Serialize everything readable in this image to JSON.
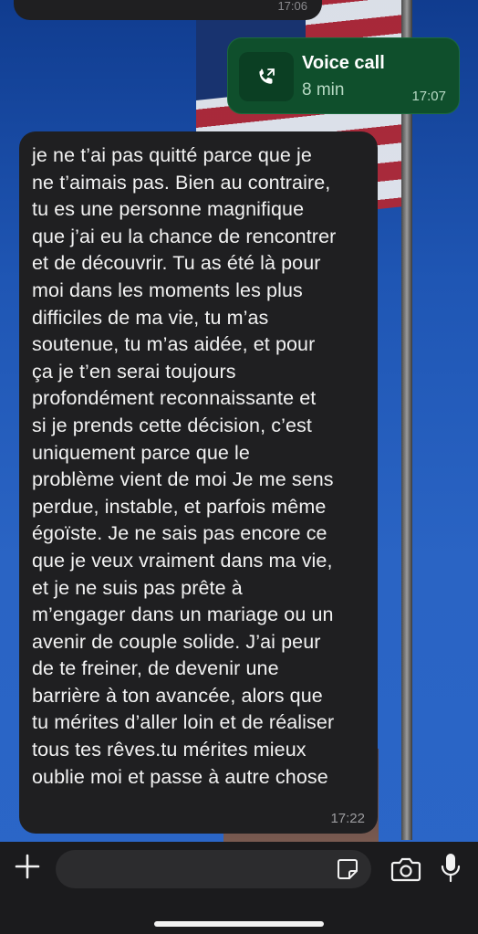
{
  "conversation": {
    "previous_message_time": "17:06",
    "call": {
      "title": "Voice call",
      "duration": "8 min",
      "time": "17:07"
    },
    "message": {
      "lines": [
        "je ne t’ai pas quitté parce que je",
        "ne t’aimais pas. Bien au contraire,",
        "tu es une personne magnifique",
        "que j’ai eu la chance de rencontrer",
        "et de découvrir. Tu as été là pour",
        "moi dans les moments les plus",
        "difficiles de ma vie, tu m’as",
        "soutenue, tu m’as aidée, et pour",
        "ça je t’en serai toujours",
        "profondément reconnaissante et",
        "si  je prends cette décision, c’est",
        "uniquement parce que le",
        "problème vient de moi Je me sens",
        "perdue, instable, et parfois même",
        "égoïste. Je ne sais pas encore ce",
        "que je veux vraiment dans ma vie,",
        "et je ne suis pas prête à",
        "m’engager dans un mariage ou un",
        "avenir de couple solide. J’ai peur",
        "de te freiner, de devenir une",
        "barrière à ton avancée, alors que",
        "tu mérites d’aller loin et de réaliser",
        "tous tes rêves.tu mérites mieux",
        "oublie moi et passe à autre chose"
      ],
      "time": "17:22"
    }
  },
  "composer": {
    "input_value": "",
    "icons": {
      "attach": "plus-icon",
      "sticker": "sticker-icon",
      "camera": "camera-icon",
      "voice": "microphone-icon"
    }
  },
  "colors": {
    "incoming_bubble": "#1f1f21",
    "outgoing_bubble": "#0f4f2c",
    "composer_bar": "#1b1b1d"
  }
}
